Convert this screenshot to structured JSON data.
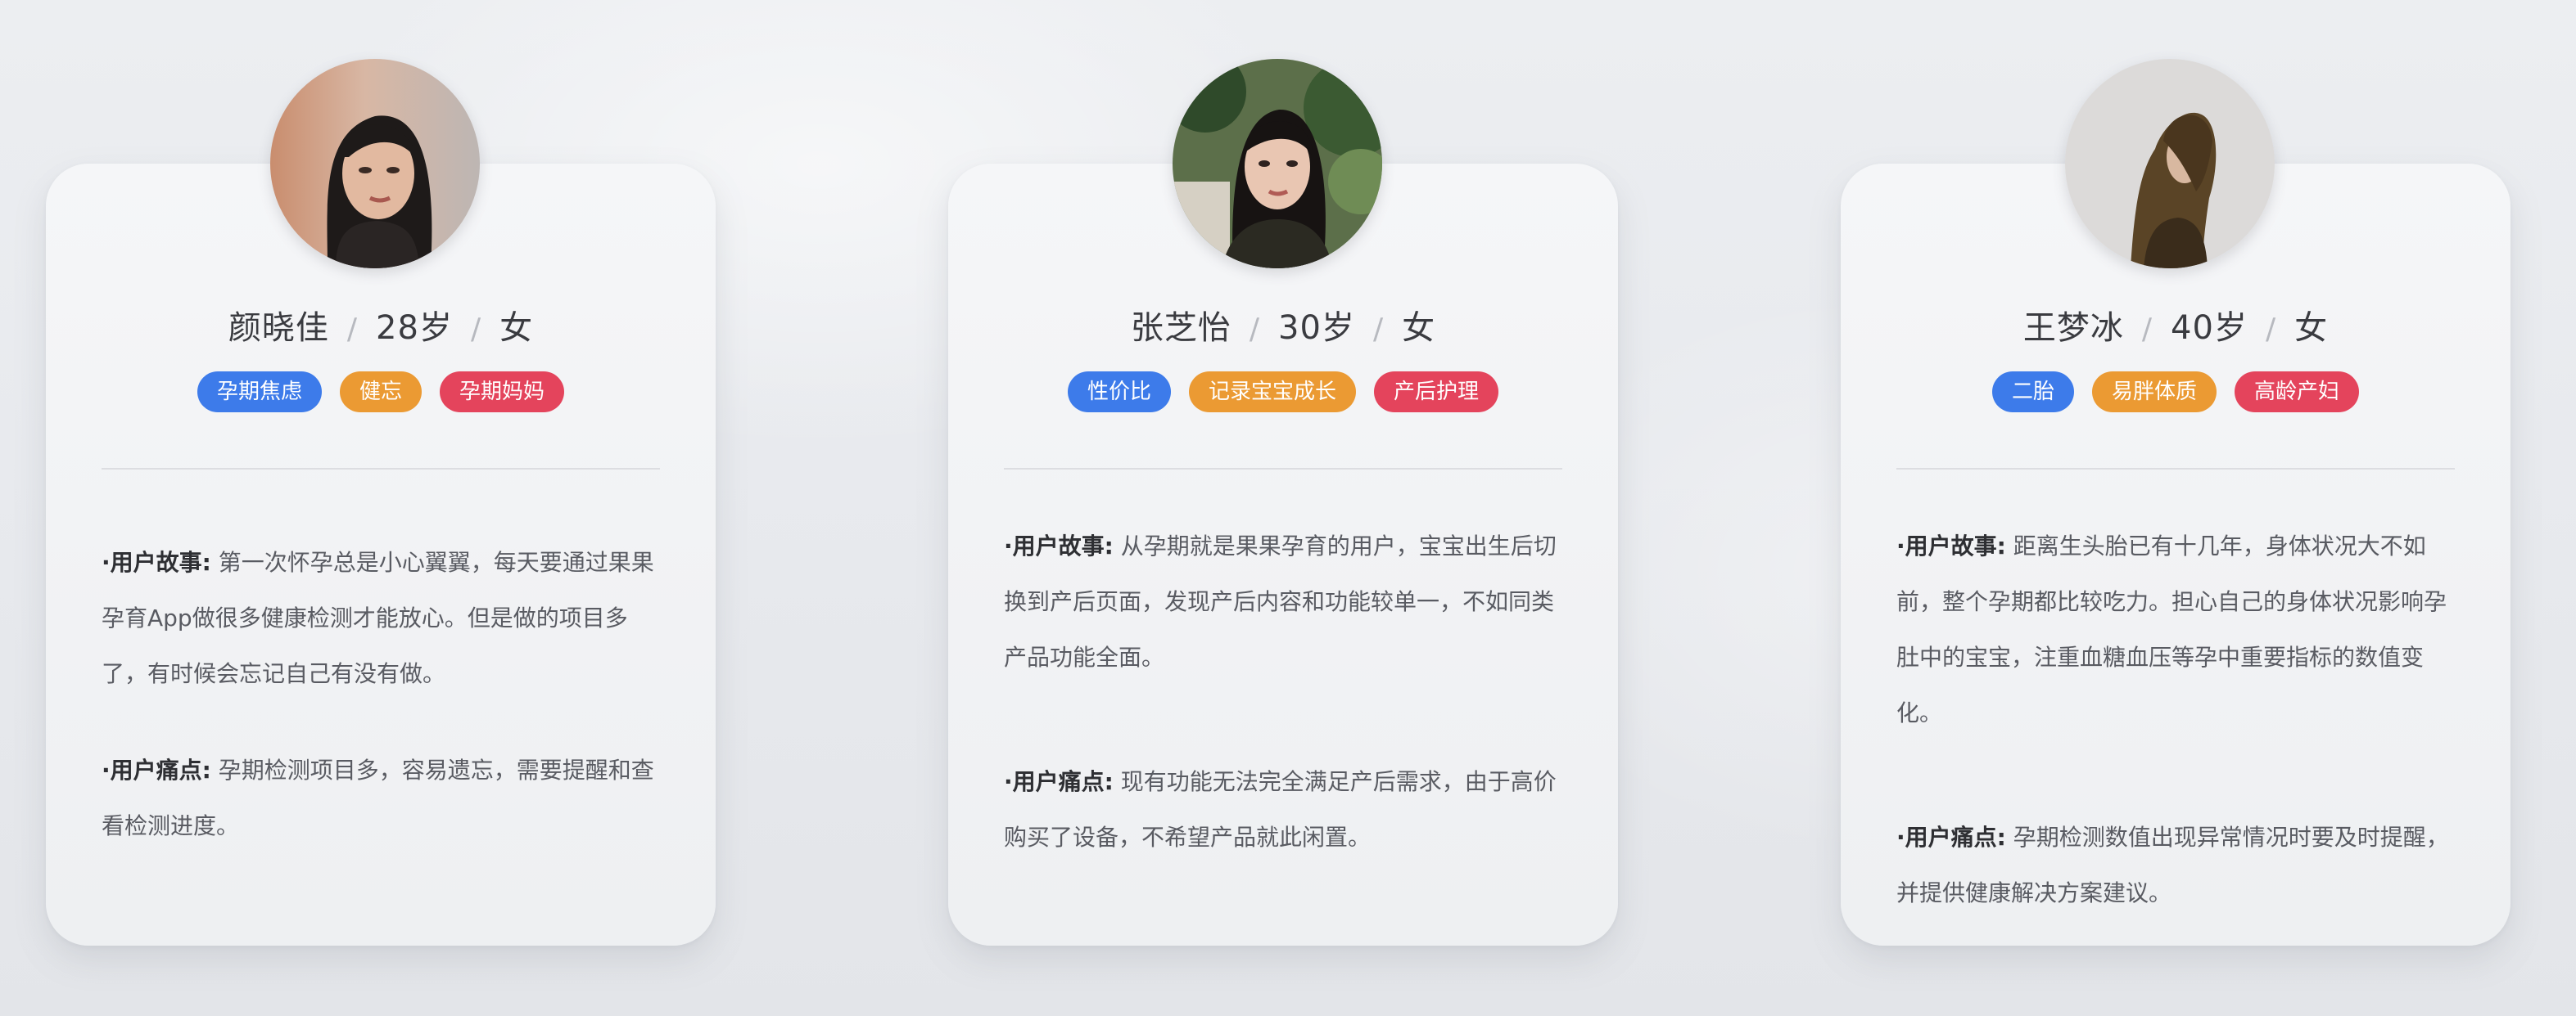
{
  "personas": [
    {
      "name": "颜晓佳",
      "age": "28岁",
      "gender": "女",
      "separator": "/",
      "tags": [
        {
          "label": "孕期焦虑",
          "color": "#3d7bea"
        },
        {
          "label": "健忘",
          "color": "#eb9a33"
        },
        {
          "label": "孕期妈妈",
          "color": "#e4445c"
        }
      ],
      "story_label": "·用户故事:",
      "story_text": "第一次怀孕总是小心翼翼，每天要通过果果孕育App做很多健康检测才能放心。但是做的项目多了，有时候会忘记自己有没有做。",
      "pain_label": "·用户痛点:",
      "pain_text": "孕期检测项目多，容易遗忘，需要提醒和查看检测进度。"
    },
    {
      "name": "张芝怡",
      "age": "30岁",
      "gender": "女",
      "separator": "/",
      "tags": [
        {
          "label": "性价比",
          "color": "#3d7bea"
        },
        {
          "label": "记录宝宝成长",
          "color": "#eb9a33"
        },
        {
          "label": "产后护理",
          "color": "#e4445c"
        }
      ],
      "story_label": "·用户故事:",
      "story_text": "从孕期就是果果孕育的用户，宝宝出生后切换到产后页面，发现产后内容和功能较单一，不如同类产品功能全面。",
      "pain_label": "·用户痛点:",
      "pain_text": "现有功能无法完全满足产后需求，由于高价购买了设备，不希望产品就此闲置。"
    },
    {
      "name": "王梦冰",
      "age": "40岁",
      "gender": "女",
      "separator": "/",
      "tags": [
        {
          "label": "二胎",
          "color": "#3d7bea"
        },
        {
          "label": "易胖体质",
          "color": "#eb9a33"
        },
        {
          "label": "高龄产妇",
          "color": "#e4445c"
        }
      ],
      "story_label": "·用户故事:",
      "story_text": "距离生头胎已有十几年，身体状况大不如前，整个孕期都比较吃力。担心自己的身体状况影响孕肚中的宝宝，注重血糖血压等孕中重要指标的数值变化。",
      "pain_label": "·用户痛点:",
      "pain_text": "孕期检测数值出现异常情况时要及时提醒，并提供健康解决方案建议。"
    }
  ]
}
